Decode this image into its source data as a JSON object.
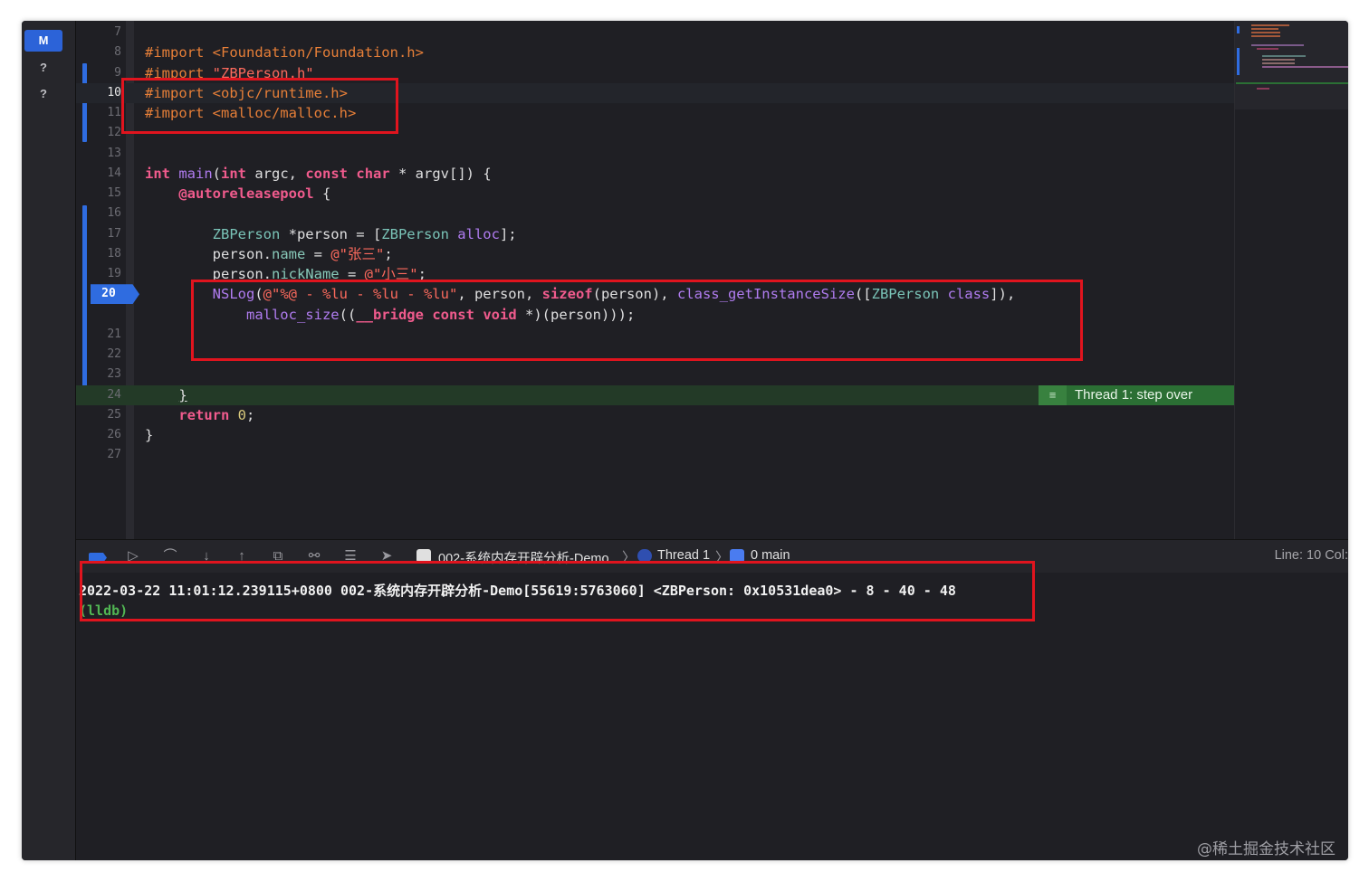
{
  "scm_status": [
    "M",
    "?",
    "?"
  ],
  "editor": {
    "lines": [
      {
        "n": "7",
        "html": ""
      },
      {
        "n": "8",
        "html": "<span class=\"pp\">#import &lt;Foundation/Foundation.h&gt;</span>"
      },
      {
        "n": "9",
        "html": "<span class=\"pp\">#import </span><span class=\"st\">\"ZBPerson.h\"</span>"
      },
      {
        "n": "10",
        "html": "<span class=\"pp\">#import &lt;objc/runtime.h&gt;</span>",
        "active": true
      },
      {
        "n": "11",
        "html": "<span class=\"pp\">#import &lt;malloc/malloc.h&gt;</span>"
      },
      {
        "n": "12",
        "html": ""
      },
      {
        "n": "13",
        "html": ""
      },
      {
        "n": "14",
        "html": "<span class=\"kw\">int</span> <span class=\"fn\">main</span>(<span class=\"kw\">int</span> argc, <span class=\"kw\">const</span> <span class=\"kw\">char</span> * argv[]) {"
      },
      {
        "n": "15",
        "html": "    <span class=\"kw\">@autoreleasepool</span> {"
      },
      {
        "n": "16",
        "html": ""
      },
      {
        "n": "17",
        "html": "        <span class=\"ty\">ZBPerson</span> *person = [<span class=\"ty\">ZBPerson</span> <span class=\"fn\">alloc</span>];"
      },
      {
        "n": "18",
        "html": "        person.<span class=\"pr\">name</span> = <span class=\"st\">@\"张三\"</span>;"
      },
      {
        "n": "19",
        "html": "        person.<span class=\"pr\">nickName</span> = <span class=\"st\">@\"小三\"</span>;"
      },
      {
        "n": "20",
        "html": "        <span class=\"fn\">NSLog</span>(<span class=\"st\">@\"%@ - %lu - %lu - %lu\"</span>, person, <span class=\"kw\">sizeof</span>(person), <span class=\"fn\">class_getInstanceSize</span>([<span class=\"ty\">ZBPerson</span> <span class=\"fn\">class</span>]),"
      },
      {
        "n": "",
        "html": "            <span class=\"fn\">malloc_size</span>((<span class=\"kw\">__bridge</span> <span class=\"kw\">const</span> <span class=\"kw\">void</span> *)(person)));"
      },
      {
        "n": "21",
        "html": ""
      },
      {
        "n": "22",
        "html": ""
      },
      {
        "n": "23",
        "html": ""
      },
      {
        "n": "24",
        "html": "    <u>}</u>"
      },
      {
        "n": "25",
        "html": "    <span class=\"kw\">return</span> <span class=\"nm\">0</span>;"
      },
      {
        "n": "26",
        "html": "}"
      },
      {
        "n": "27",
        "html": ""
      }
    ],
    "breakpoint_line": "20",
    "debug_banner": "Thread 1: step over"
  },
  "debugbar": {
    "target": "002-系统内存开辟分析-Demo",
    "thread": "Thread 1",
    "frame": "0 main",
    "line_info": "Line: 10  Col:"
  },
  "console": {
    "output": "2022-03-22 11:01:12.239115+0800 002-系统内存开辟分析-Demo[55619:5763060] <ZBPerson: 0x10531dea0> - 8 - 40 - 48",
    "prompt": "(lldb)"
  },
  "watermark": "@稀土掘金技术社区",
  "colors": {
    "accent": "#2f6ce0",
    "annotation": "#e0141e",
    "debug_line": "#233a27"
  }
}
